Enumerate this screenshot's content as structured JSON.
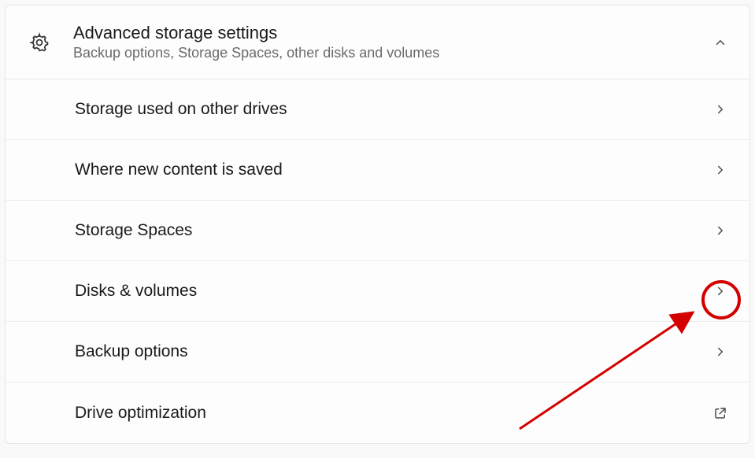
{
  "header": {
    "title": "Advanced storage settings",
    "subtitle": "Backup options, Storage Spaces, other disks and volumes"
  },
  "items": [
    {
      "label": "Storage used on other drives",
      "action": "navigate"
    },
    {
      "label": "Where new content is saved",
      "action": "navigate"
    },
    {
      "label": "Storage Spaces",
      "action": "navigate"
    },
    {
      "label": "Disks & volumes",
      "action": "navigate"
    },
    {
      "label": "Backup options",
      "action": "navigate"
    },
    {
      "label": "Drive optimization",
      "action": "external"
    }
  ],
  "annotation": {
    "circle_target_index": 3,
    "color": "#d40000"
  }
}
